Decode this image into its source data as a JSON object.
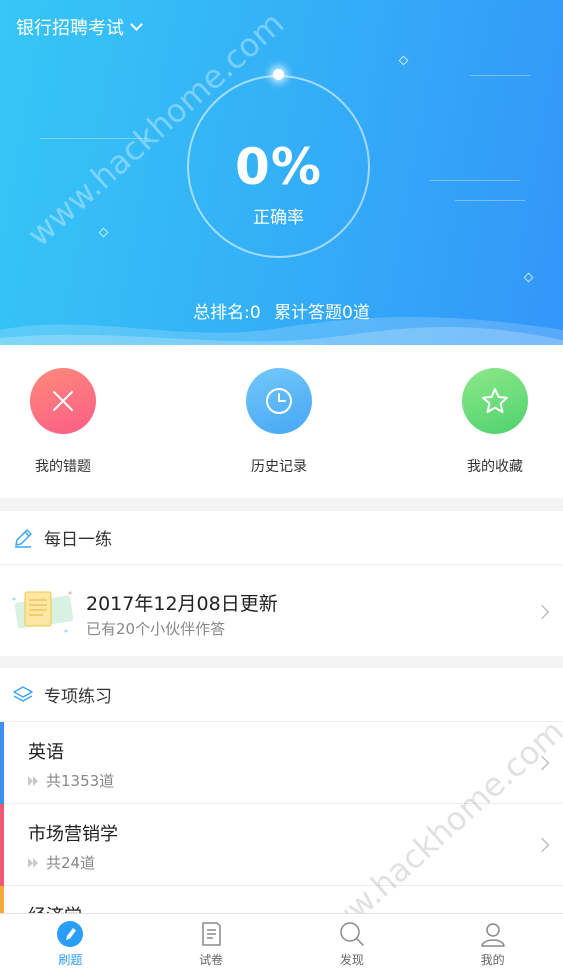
{
  "header": {
    "exam_name": "银行招聘考试",
    "accuracy_value": "0%",
    "accuracy_label": "正确率",
    "rank_text": "总排名:0",
    "answered_text": "累计答题0道"
  },
  "quick_actions": [
    {
      "label": "我的错题",
      "icon": "x-icon"
    },
    {
      "label": "历史记录",
      "icon": "clock-icon"
    },
    {
      "label": "我的收藏",
      "icon": "star-icon"
    }
  ],
  "daily": {
    "section_title": "每日一练",
    "update_title": "2017年12月08日更新",
    "participants": "已有20个小伙伴作答"
  },
  "special": {
    "section_title": "专项练习",
    "topics": [
      {
        "name": "英语",
        "count": "共1353道",
        "color": "#3d8ff0"
      },
      {
        "name": "市场营销学",
        "count": "共24道",
        "color": "#f0587a"
      },
      {
        "name": "经济学",
        "count": "",
        "color": "#f5a93b"
      }
    ]
  },
  "nav": [
    {
      "label": "刷题",
      "icon": "pen-icon",
      "active": true
    },
    {
      "label": "试卷",
      "icon": "paper-icon",
      "active": false
    },
    {
      "label": "发现",
      "icon": "search-icon",
      "active": false
    },
    {
      "label": "我的",
      "icon": "user-icon",
      "active": false
    }
  ],
  "watermark": "www.hackhome.com",
  "colors": {
    "accent": "#2a9df4",
    "header_start": "#37c6f5",
    "header_end": "#3396f9"
  }
}
